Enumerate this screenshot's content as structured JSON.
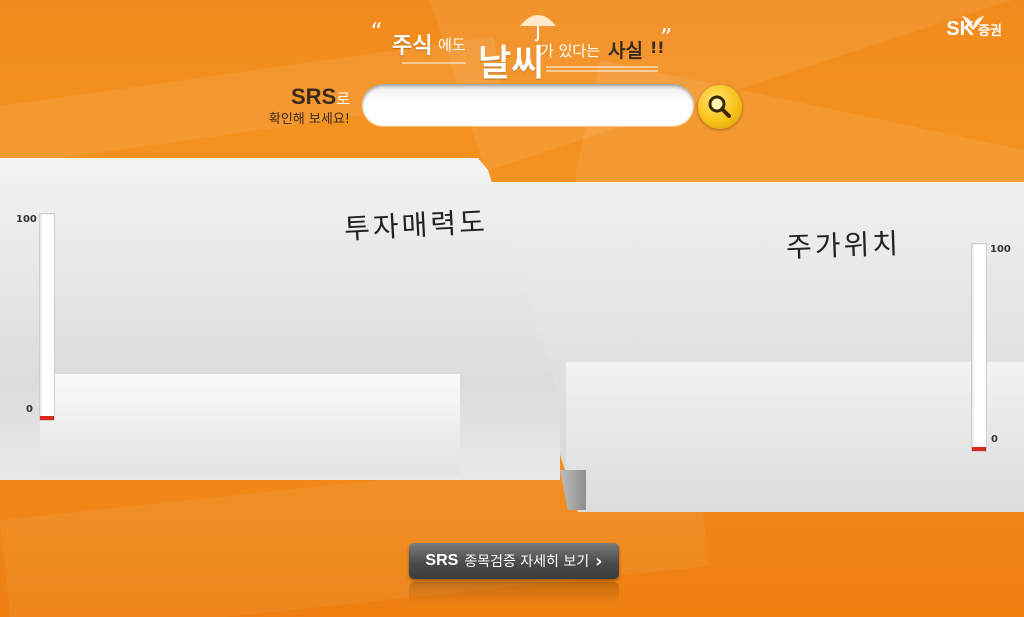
{
  "brand": {
    "logo_mark": "SK",
    "logo_sub": "증권"
  },
  "headline": {
    "open_quote": "“",
    "close_quote": "”",
    "w1": "주식",
    "w2": "에도",
    "w3": "날씨",
    "w4": "가 있다는",
    "w5": "사실",
    "w6": "!!"
  },
  "search": {
    "srs": "SRS",
    "ro": "로",
    "prompt": "확인해 보세요!",
    "value": "",
    "placeholder": ""
  },
  "panels": {
    "left": {
      "title": "투자매력도",
      "scale_max": "100",
      "scale_min": "0",
      "level": 0
    },
    "right": {
      "title": "주가위치",
      "scale_max": "100",
      "scale_min": "0",
      "level": 0
    }
  },
  "detail_button": {
    "srs": "SRS",
    "label": "종목검증 자세히 보기",
    "arrow": "›"
  },
  "icons": {
    "search": "search-icon",
    "umbrella": "umbrella-icon",
    "arrow": "chevron-right-icon"
  },
  "colors": {
    "background": "#f39020",
    "gauge_fill": "#d9271a",
    "search_button": "#f7c21a"
  }
}
